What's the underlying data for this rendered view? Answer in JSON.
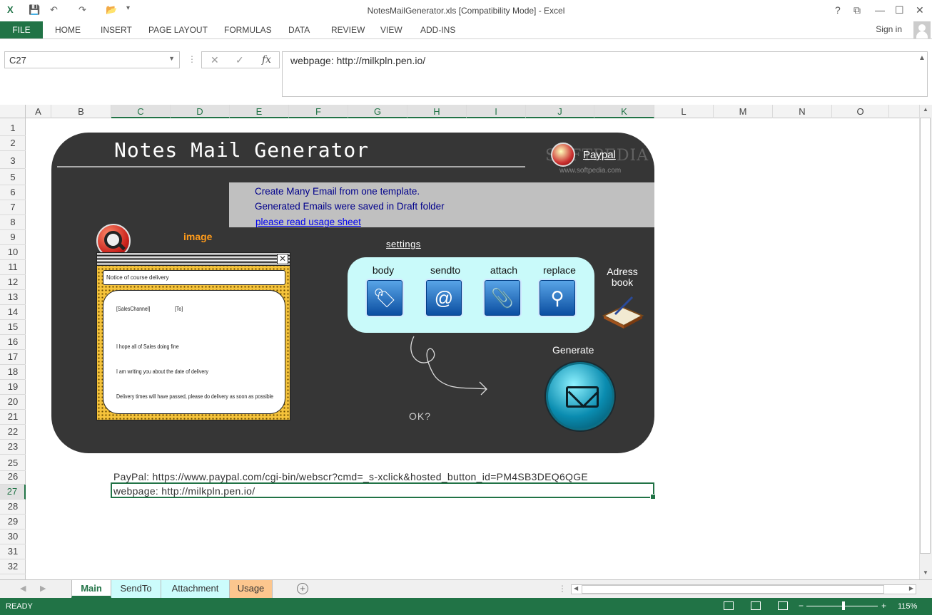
{
  "window": {
    "title": "NotesMailGenerator.xls  [Compatibility Mode] - Excel",
    "help": "?",
    "min": "—",
    "max": "☐",
    "close": "✕",
    "restore": "⧉"
  },
  "quick": {
    "save_icon": "💾",
    "undo_icon": "↶",
    "redo_icon": "↷",
    "open_icon": "📂",
    "customize": "▾"
  },
  "ribbon": {
    "file": "FILE",
    "tabs": [
      "HOME",
      "INSERT",
      "PAGE LAYOUT",
      "FORMULAS",
      "DATA",
      "REVIEW",
      "VIEW",
      "ADD-INS"
    ],
    "signin": "Sign in"
  },
  "formula_bar": {
    "name_box": "C27",
    "cancel": "✕",
    "enter": "✓",
    "fx": "fx",
    "content": "webpage: http://milkpln.pen.io/"
  },
  "columns": [
    "A",
    "B",
    "C",
    "D",
    "E",
    "F",
    "G",
    "H",
    "I",
    "J",
    "K",
    "L",
    "M",
    "N",
    "O"
  ],
  "rows": [
    "1",
    "2",
    "3",
    "5",
    "6",
    "7",
    "8",
    "9",
    "10",
    "11",
    "12",
    "13",
    "14",
    "15",
    "16",
    "17",
    "18",
    "19",
    "20",
    "21",
    "22",
    "23",
    "25",
    "26",
    "27",
    "28",
    "29",
    "30",
    "31",
    "32"
  ],
  "app": {
    "title": "Notes Mail Generator",
    "paypal": "Paypal",
    "watermark": "SOFTPEDIA",
    "watermark_url": "www.softpedia.com",
    "info_line1": "Create Many Email from one template.",
    "info_line2": "Generated Emails were saved in Draft folder",
    "usage_link": "please read usage sheet",
    "image_label": "image",
    "mail_subject": "Notice of course delivery",
    "mail_channel": "[SalesChannel]",
    "mail_to": "[To]",
    "mail_line1": "I hope all of Sales doing fine",
    "mail_line2": "I am writing you about the date of delivery",
    "mail_line3": "Delivery times will have passed, please do delivery as soon as possible",
    "settings": "settings",
    "body": "body",
    "sendto": "sendto",
    "attach": "attach",
    "replace": "replace",
    "adress_book": "Adress book",
    "generate": "Generate",
    "ok": "OK?"
  },
  "cells": {
    "paypal_row": "PayPal:  https://www.paypal.com/cgi-bin/webscr?cmd=_s-xclick&hosted_button_id=PM4SB3DEQ6QGE",
    "webpage_row": "webpage: http://milkpln.pen.io/"
  },
  "sheets": [
    "Main",
    "SendTo",
    "Attachment",
    "Usage"
  ],
  "status": {
    "ready": "READY",
    "zoom": "115%",
    "zoom_minus": "−",
    "zoom_plus": "+"
  }
}
